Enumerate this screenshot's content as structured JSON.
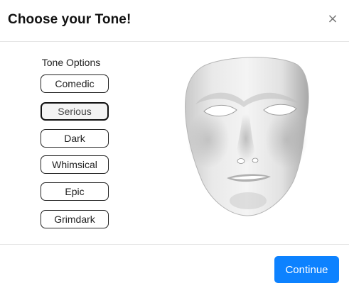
{
  "dialog": {
    "title": "Choose your Tone!",
    "close_icon": "close-icon",
    "close_glyph": "×"
  },
  "tone_options": {
    "heading": "Tone Options",
    "items": [
      {
        "label": "Comedic"
      },
      {
        "label": "Serious"
      },
      {
        "label": "Dark"
      },
      {
        "label": "Whimsical"
      },
      {
        "label": "Epic"
      },
      {
        "label": "Grimdark"
      }
    ],
    "selected": "Serious"
  },
  "preview": {
    "image": "white-face-mask"
  },
  "footer": {
    "continue_label": "Continue"
  },
  "colors": {
    "accent": "#0d82ff",
    "border": "#e6e6e6",
    "text": "#111111"
  }
}
